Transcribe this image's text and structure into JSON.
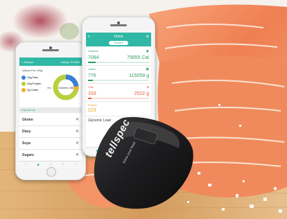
{
  "left_phone": {
    "back_label": "< Analyze",
    "action_label": "Assign To Meal",
    "values_per": "Values Per 100g",
    "legend": [
      "15g Fats",
      "20g Protein",
      "2g Carbs"
    ],
    "donut_center": "Calories 266",
    "donut_side": "75%",
    "ingredients_header": "Ingredients",
    "ingredients": [
      "Gluten",
      "Diary",
      "Soya",
      "Sugars"
    ]
  },
  "right_phone": {
    "title": "Home",
    "subtitle": "Today ▾",
    "metrics": [
      {
        "label": "Calories",
        "value": "7084",
        "target": "75655 Cal",
        "color": "#2e9e62"
      },
      {
        "label": "Carbs",
        "value": "776",
        "target": "115059 g",
        "color": "#2e9e62"
      },
      {
        "label": "Fats",
        "value": "153",
        "target": "2522 g",
        "color": "#e55b3a"
      },
      {
        "label": "Protein",
        "value": "223",
        "target": "",
        "color": "#e6a117"
      }
    ],
    "glycemic": "Glycemic Load"
  },
  "device": {
    "brand": "tellspec",
    "tagline": "know your food",
    "body_color": "#1c1c1e"
  },
  "colors": {
    "app_accent": "#2fb8a5",
    "salmon": "#f28a5e",
    "wood": "#d9a86a"
  }
}
